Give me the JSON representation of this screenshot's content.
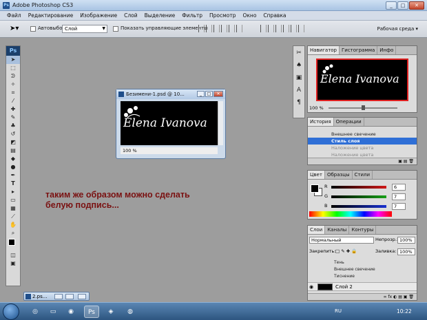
{
  "window": {
    "title": "Adobe Photoshop CS3",
    "app_badge": "Ps"
  },
  "menu": [
    "Файл",
    "Редактирование",
    "Изображение",
    "Слой",
    "Выделение",
    "Фильтр",
    "Просмотр",
    "Окно",
    "Справка"
  ],
  "options_bar": {
    "autoselect_label": "Автовыбор:",
    "autoselect_value": "Слой",
    "show_controls_label": "Показать управляющие элементы",
    "workspace_label": "Рабочая среда"
  },
  "tools_badge": "Ps",
  "document": {
    "title": "Безимени-1.psd @ 10...",
    "zoom": "100 %",
    "text": "Elena Ivanova"
  },
  "annotation": {
    "line1": "таким же образом можно сделать",
    "line2": "белую подпись..."
  },
  "minimized_doc": "2.ps...",
  "navigator": {
    "tabs": [
      "Навигатор",
      "Гистограмма",
      "Инфо"
    ],
    "zoom": "100 %",
    "thumb_text": "Elena Ivanova"
  },
  "history": {
    "tabs": [
      "История",
      "Операции"
    ],
    "items": [
      {
        "label": "Внешнее свечение",
        "state": "normal"
      },
      {
        "label": "Стиль слоя",
        "state": "selected"
      },
      {
        "label": "Наложение цвета",
        "state": "dim"
      },
      {
        "label": "Наложение цвета",
        "state": "dim"
      }
    ]
  },
  "color_panel": {
    "tabs": [
      "Цвет",
      "Образцы",
      "Стили"
    ],
    "channels": [
      {
        "label": "R",
        "value": "6",
        "color": "#d01818"
      },
      {
        "label": "G",
        "value": "7",
        "color": "#18a018"
      },
      {
        "label": "B",
        "value": "7",
        "color": "#1830d0"
      }
    ]
  },
  "layers": {
    "tabs": [
      "Слои",
      "Каналы",
      "Контуры"
    ],
    "blend_mode": "Нормальный",
    "opacity_label": "Непрозр.:",
    "opacity_value": "100%",
    "lock_label": "Закрепить:",
    "fill_label": "Заливка:",
    "fill_value": "100%",
    "effects": [
      "Тень",
      "Внешнее свечение",
      "Тиснение"
    ],
    "layer_name": "Слой 2"
  },
  "taskbar": {
    "lang": "RU",
    "clock": "10:22"
  }
}
